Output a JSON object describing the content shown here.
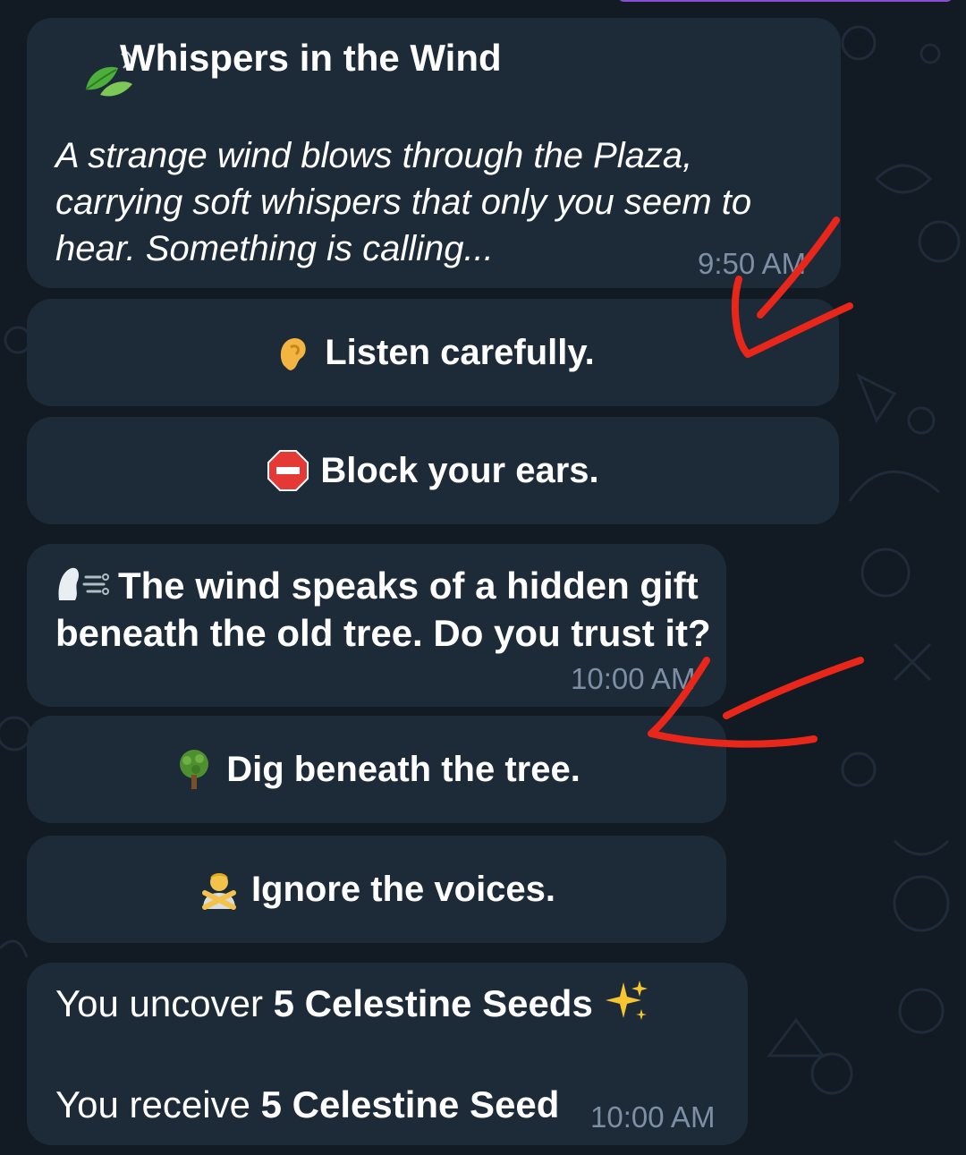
{
  "colors": {
    "background": "#121b24",
    "bubble": "#1d2a38",
    "text": "#ffffff",
    "timestamp": "#7d8fa4",
    "annotation": "#e8261a",
    "accent": "#8a4dd6"
  },
  "messages": [
    {
      "icon": "leaves-icon",
      "title": "Whispers in the Wind",
      "body": "A strange wind blows through the Plaza, carrying soft whispers that only you seem to hear. Something is calling...",
      "time": "9:50 AM",
      "buttons": [
        {
          "icon": "ear-icon",
          "label": "Listen carefully."
        },
        {
          "icon": "stop-sign-icon",
          "label": "Block your ears."
        }
      ]
    },
    {
      "icon": "wind-face-icon",
      "text": "The wind speaks of a hidden gift beneath the old tree. Do you trust it?",
      "time": "10:00 AM",
      "buttons": [
        {
          "icon": "tree-icon",
          "label": "Dig beneath the tree."
        },
        {
          "icon": "person-gesturing-no-icon",
          "label": "Ignore the voices."
        }
      ]
    },
    {
      "line1_prefix": "You uncover ",
      "line1_bold": "5 Celestine Seeds",
      "line1_icon": "sparkles-icon",
      "line2_prefix": "You receive ",
      "line2_bold": "5 Celestine Seed",
      "time": "10:00 AM"
    }
  ]
}
